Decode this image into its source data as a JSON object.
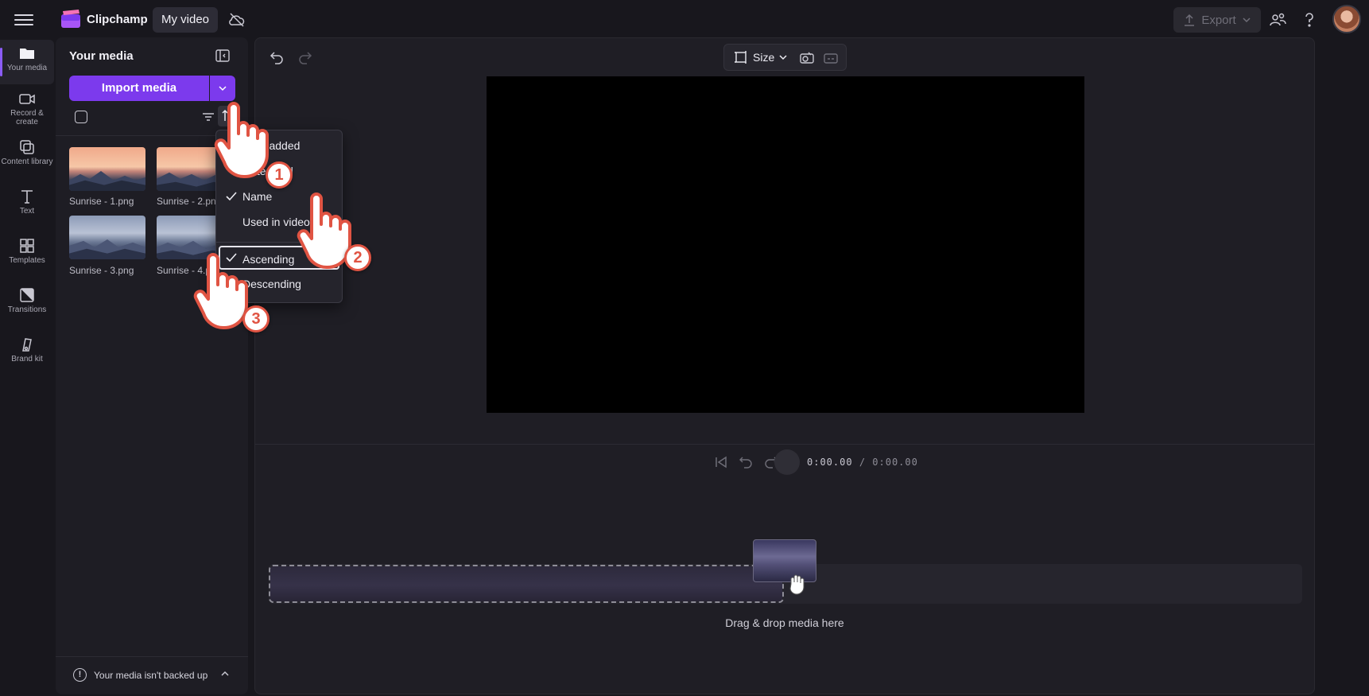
{
  "topbar": {
    "app_name": "Clipchamp",
    "project_name": "My video",
    "export_label": "Export"
  },
  "rail": {
    "items": [
      {
        "label": "Your media",
        "icon": "folder-icon",
        "active": true
      },
      {
        "label": "Record & create",
        "icon": "camera-icon"
      },
      {
        "label": "Content library",
        "icon": "library-icon"
      },
      {
        "label": "Text",
        "icon": "text-icon"
      },
      {
        "label": "Templates",
        "icon": "templates-icon"
      },
      {
        "label": "Transitions",
        "icon": "transitions-icon"
      },
      {
        "label": "Brand kit",
        "icon": "brand-kit-icon"
      }
    ]
  },
  "media_panel": {
    "title": "Your media",
    "import_label": "Import media",
    "items": [
      {
        "name": "Sunrise - 1.png",
        "style": "sunset"
      },
      {
        "name": "Sunrise - 2.png",
        "style": "sunset"
      },
      {
        "name": "Sunrise - 3.png",
        "style": "blue"
      },
      {
        "name": "Sunrise - 4.png",
        "style": "blue"
      }
    ],
    "backup_text": "Your media isn't backed up"
  },
  "sort_menu": {
    "items": [
      {
        "label": "Date added",
        "checked": false
      },
      {
        "label": "Date used",
        "checked": false
      },
      {
        "label": "Name",
        "checked": true
      },
      {
        "label": "Used in video",
        "checked": false
      }
    ],
    "order_items": [
      {
        "label": "Ascending",
        "checked": true
      },
      {
        "label": "Descending",
        "checked": false
      }
    ]
  },
  "preview": {
    "size_label": "Size",
    "time_current": "0:00.00",
    "time_total": "0:00.00",
    "time_separator": "/"
  },
  "timeline": {
    "drop_label": "Drag & drop media here"
  },
  "annotations": {
    "steps": [
      "1",
      "2",
      "3"
    ]
  },
  "colors": {
    "accent": "#7c3aed",
    "background": "#18171d",
    "annotation": "#e05443"
  }
}
